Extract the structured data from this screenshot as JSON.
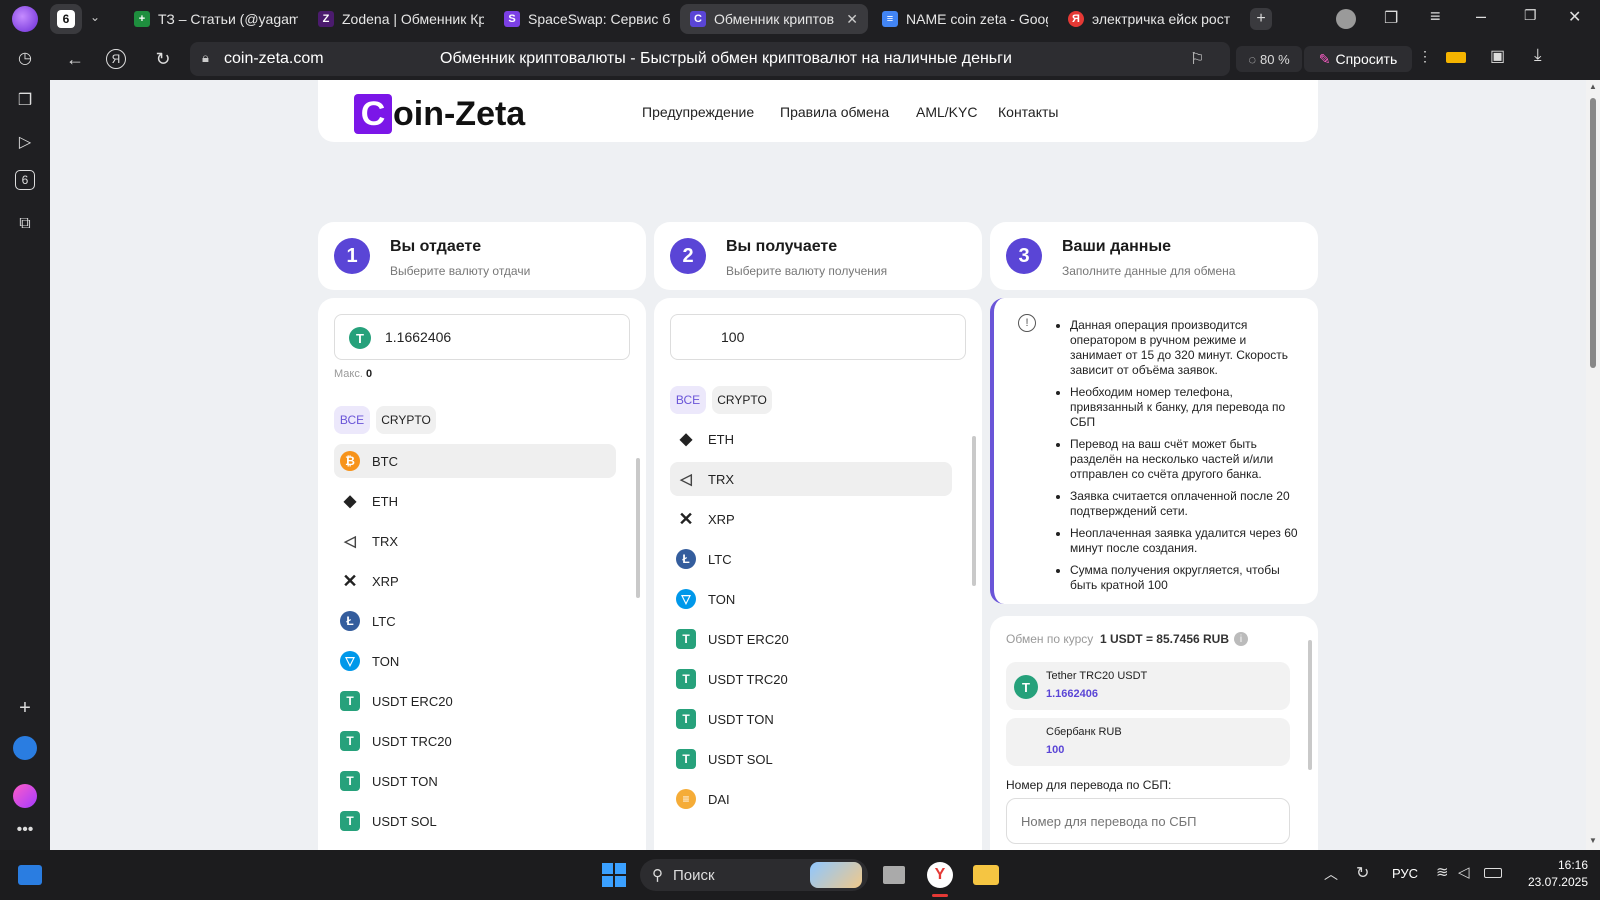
{
  "browser": {
    "tab_count": "6",
    "tabs": [
      {
        "title": "ТЗ – Статьи (@yagami",
        "fav_color": "#1e8e3e",
        "fav_glyph": "+"
      },
      {
        "title": "Zodena | Обменник Кр",
        "fav_color": "#4b1b6e",
        "fav_glyph": "Z"
      },
      {
        "title": "SpaceSwap: Сервис бл",
        "fav_color": "#7b3fe4",
        "fav_glyph": "S"
      },
      {
        "title": "Обменник криптов",
        "fav_color": "#5a45d6",
        "fav_glyph": "C"
      },
      {
        "title": "NAME coin zeta - Goog",
        "fav_color": "#4285f4",
        "fav_glyph": "≡"
      },
      {
        "title": "электричка ейск рост",
        "fav_color": "#e53935",
        "fav_glyph": "Я"
      }
    ],
    "url": "coin-zeta.com",
    "page_title": "Обменник криптовалюты - Быстрый обмен криптовалют на наличные деньги",
    "zoom": "80 %",
    "ask_label": "Спросить"
  },
  "site": {
    "logo_letter": "C",
    "logo_rest": "oin-Zeta",
    "nav": [
      "Предупреждение",
      "Правила обмена",
      "AML/KYC",
      "Контакты"
    ]
  },
  "steps": [
    {
      "num": "1",
      "title": "Вы отдаете",
      "subtitle": "Выберите валюту отдачи"
    },
    {
      "num": "2",
      "title": "Вы получаете",
      "subtitle": "Выберите валюту получения"
    },
    {
      "num": "3",
      "title": "Ваши данные",
      "subtitle": "Заполните данные для обмена"
    }
  ],
  "give": {
    "amount": "1.1662406",
    "max_label": "Макс.",
    "max_value": "0",
    "filters": [
      "ВСЕ",
      "CRYPTO"
    ],
    "currencies": [
      "BTC",
      "ETH",
      "TRX",
      "XRP",
      "LTC",
      "TON",
      "USDT ERC20",
      "USDT TRC20",
      "USDT TON",
      "USDT SOL"
    ]
  },
  "receive": {
    "amount": "100",
    "filters": [
      "ВСЕ",
      "CRYPTO"
    ],
    "currencies": [
      "ETH",
      "TRX",
      "XRP",
      "LTC",
      "TON",
      "USDT ERC20",
      "USDT TRC20",
      "USDT TON",
      "USDT SOL",
      "DAI"
    ]
  },
  "info": {
    "items": [
      "Данная операция производится оператором в ручном режиме и занимает от 15 до 320 минут. Скорость зависит от объёма заявок.",
      "Необходим номер телефона, привязанный к банку, для перевода по СБП",
      "Перевод на ваш счёт может быть разделён на несколько частей и/или отправлен со счёта другого банка.",
      "Заявка считается оплаченной после 20 подтверждений сети.",
      "Неоплаченная заявка удалится через 60 минут после создания.",
      "Сумма получения округляется, чтобы быть кратной 100"
    ]
  },
  "summary": {
    "rate_label": "Обмен по курсу",
    "rate_value": "1 USDT = 85.7456 RUB",
    "from_name": "Tether TRC20 USDT",
    "from_amount": "1.1662406",
    "to_name": "Сбербанк RUB",
    "to_amount": "100",
    "phone_label": "Номер для перевода по СБП:",
    "phone_placeholder": "Номер для перевода по СБП"
  },
  "taskbar": {
    "search_label": "Поиск",
    "lang": "РУС",
    "time": "16:16",
    "date": "23.07.2025"
  },
  "colors": {
    "accent": "#5a45d6",
    "tether": "#26a17b",
    "btc": "#f7931a",
    "ltc": "#345d9d",
    "ton": "#0098ea",
    "dai": "#f5ac37"
  }
}
